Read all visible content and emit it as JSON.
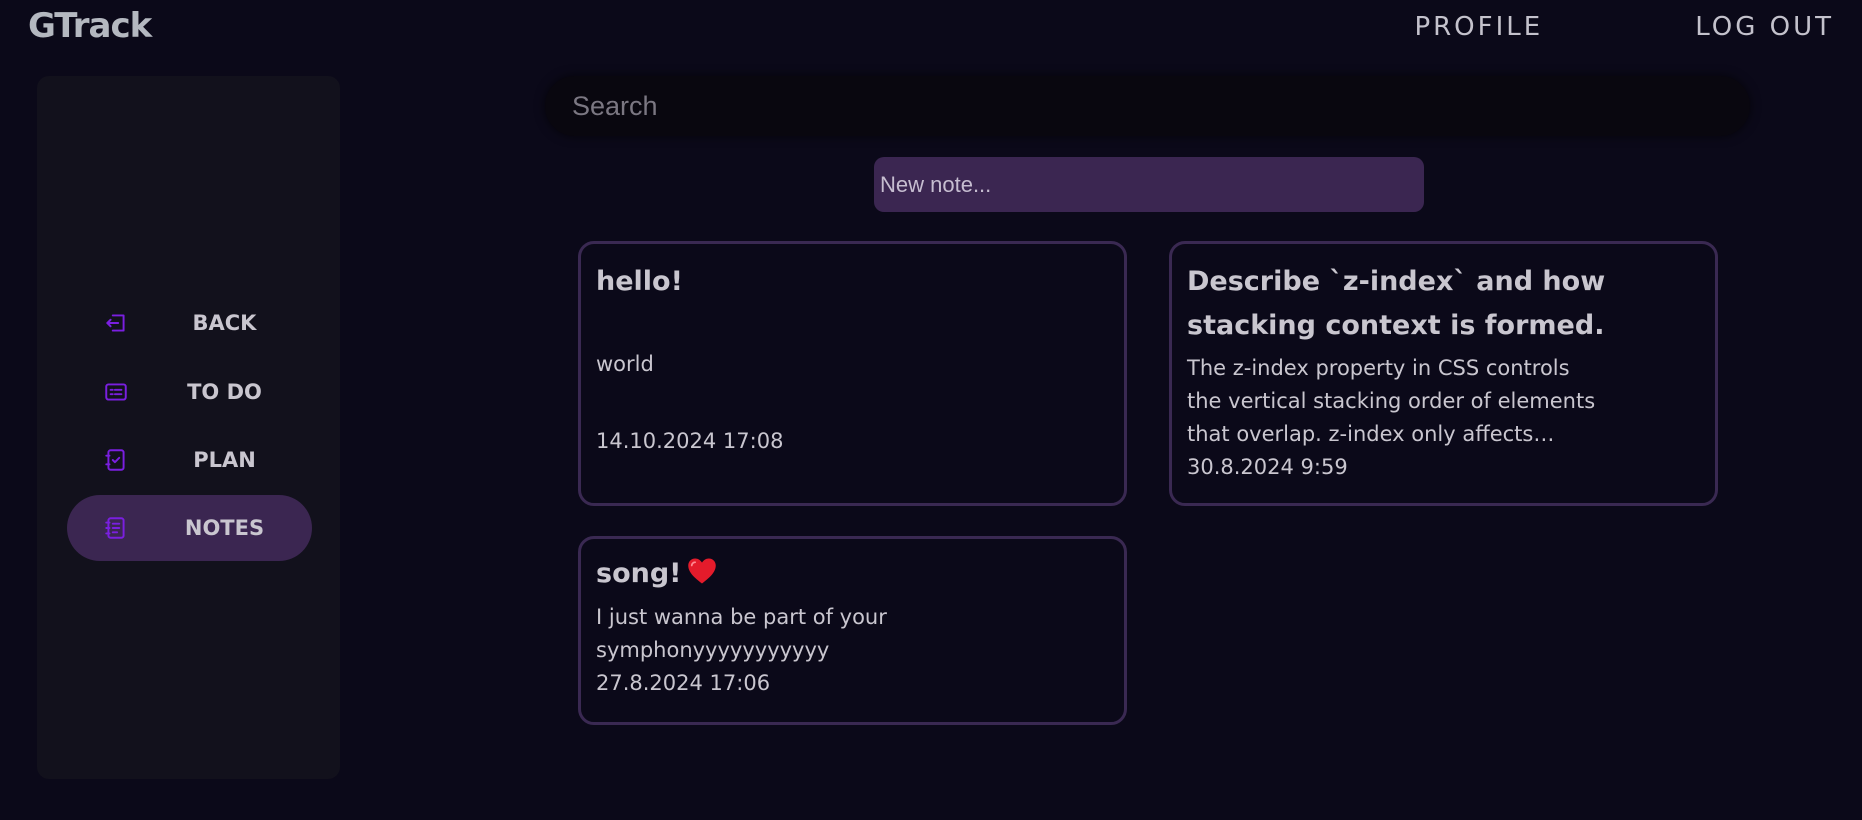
{
  "app": {
    "logo": "GTrack"
  },
  "topnav": {
    "profile": "PROFILE",
    "logout": "LOG OUT"
  },
  "sidebar": {
    "items": [
      {
        "label": "BACK",
        "icon": "back-icon",
        "active": false
      },
      {
        "label": "TO DO",
        "icon": "todo-list-icon",
        "active": false
      },
      {
        "label": "PLAN",
        "icon": "plan-checklist-icon",
        "active": false
      },
      {
        "label": "NOTES",
        "icon": "notes-icon",
        "active": true
      }
    ]
  },
  "search": {
    "placeholder": "Search",
    "value": ""
  },
  "new_note": {
    "placeholder": "New note...",
    "value": ""
  },
  "notes": [
    {
      "title": "hello!",
      "body": "world",
      "date": "14.10.2024 17:08"
    },
    {
      "title_line1": "Describe `z-index` and how",
      "title_line2": "stacking context is formed.",
      "body_line1": "The z-index property in CSS controls",
      "body_line2": "the vertical stacking order of elements",
      "body_line3": "that overlap. z-index only affects…",
      "date": "30.8.2024 9:59"
    },
    {
      "title": "song!",
      "title_icon": "heart-icon",
      "body_line1": "I just wanna be part of your",
      "body_line2": "symphonyyyyyyyyyyy",
      "date": "27.8.2024 17:06"
    }
  ],
  "colors": {
    "background": "#0b0919",
    "sidebar": "#12111c",
    "accent": "#3b2651",
    "card_border": "#3a2952",
    "icon": "#7a1fe0",
    "text": "#c9c6cf"
  }
}
